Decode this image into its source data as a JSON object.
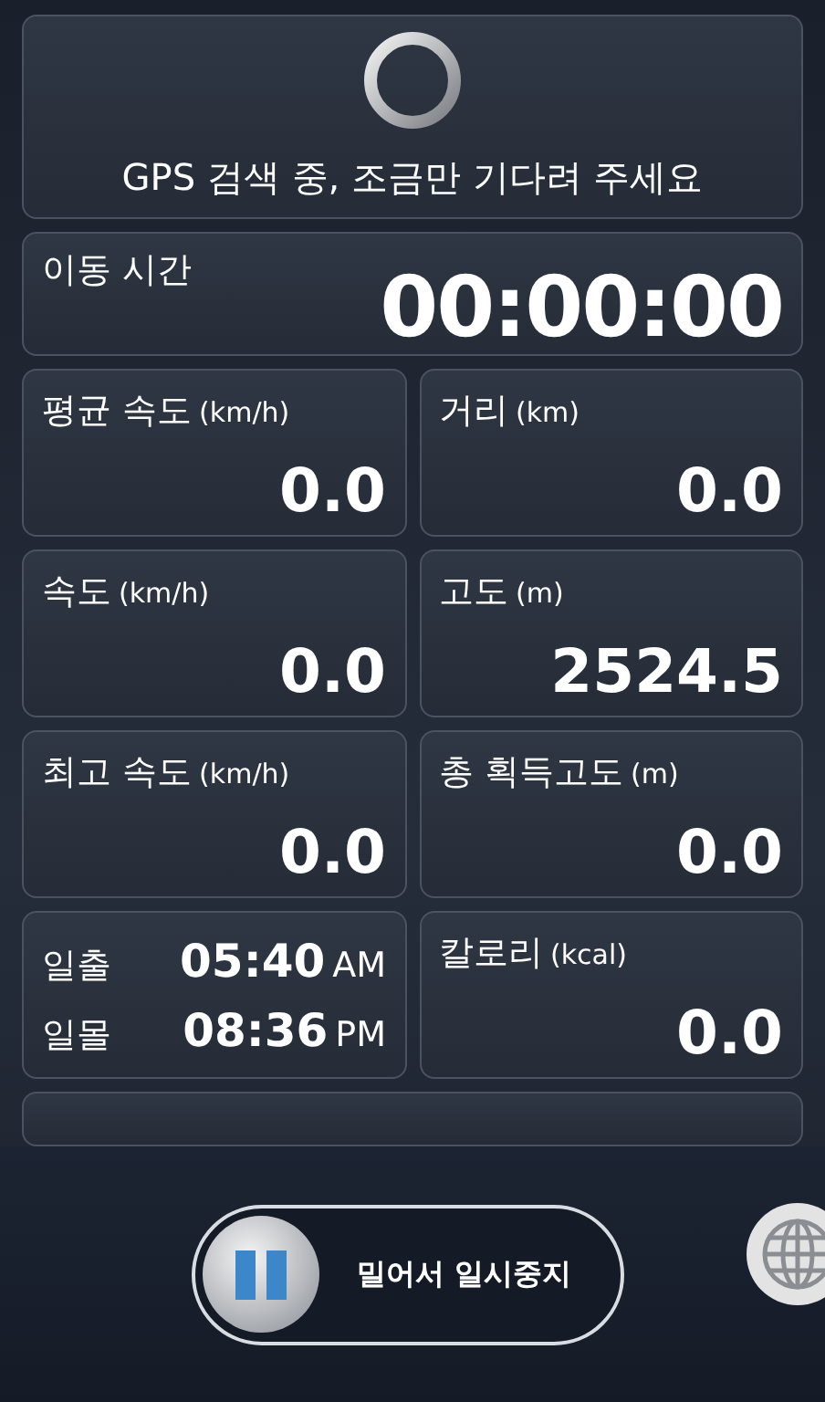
{
  "gps_status": {
    "message": "GPS 검색 중, 조금만 기다려 주세요"
  },
  "moving_time": {
    "label": "이동 시간",
    "value": "00:00:00"
  },
  "stats": [
    {
      "kind": "metric",
      "label": "평균 속도",
      "unit": "(km/h)",
      "value": "0.0"
    },
    {
      "kind": "metric",
      "label": "거리",
      "unit": "(km)",
      "value": "0.0"
    },
    {
      "kind": "metric",
      "label": "속도",
      "unit": "(km/h)",
      "value": "0.0"
    },
    {
      "kind": "metric",
      "label": "고도",
      "unit": "(m)",
      "value": "2524.5"
    },
    {
      "kind": "metric",
      "label": "최고 속도",
      "unit": "(km/h)",
      "value": "0.0"
    },
    {
      "kind": "metric",
      "label": "총 획득고도",
      "unit": "(m)",
      "value": "0.0"
    },
    {
      "kind": "sun",
      "rows": [
        {
          "label": "일출",
          "time": "05:40",
          "ampm": "AM"
        },
        {
          "label": "일몰",
          "time": "08:36",
          "ampm": "PM"
        }
      ]
    },
    {
      "kind": "metric",
      "label": "칼로리",
      "unit": "(kcal)",
      "value": "0.0"
    }
  ],
  "slider": {
    "label": "밀어서 일시중지",
    "level": 0
  }
}
